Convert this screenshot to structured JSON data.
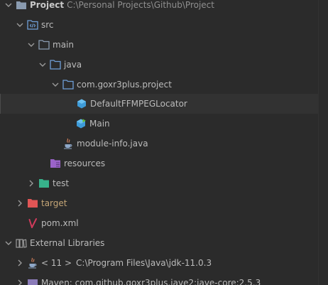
{
  "tree": {
    "project": {
      "label": "Project",
      "path": "C:\\Personal Projects\\Github\\Project"
    },
    "src": {
      "label": "src"
    },
    "main": {
      "label": "main"
    },
    "java": {
      "label": "java"
    },
    "package": {
      "label": "com.goxr3plus.project"
    },
    "class_locator": {
      "label": "DefaultFFMPEGLocator"
    },
    "class_main": {
      "label": "Main"
    },
    "module_info": {
      "label": "module-info.java"
    },
    "resources": {
      "label": "resources"
    },
    "test": {
      "label": "test"
    },
    "target": {
      "label": "target"
    },
    "pom": {
      "label": "pom.xml"
    },
    "external_libraries": {
      "label": "External Libraries"
    },
    "jdk": {
      "version": "< 11 >",
      "path": "C:\\Program Files\\Java\\jdk-11.0.3"
    },
    "maven": {
      "label": "Maven: com.github.goxr3plus.jave2:jave-core:2.5.3"
    }
  },
  "colors": {
    "background": "#2b2b2b",
    "folder": "#8a9bb0",
    "source_folder": "#6f9fd8",
    "class_icon": "#3e9bd8",
    "resources_folder": "#9a63c8",
    "test_folder": "#37b28b",
    "target_folder": "#e05555",
    "maven_icon": "#d03b5b"
  }
}
